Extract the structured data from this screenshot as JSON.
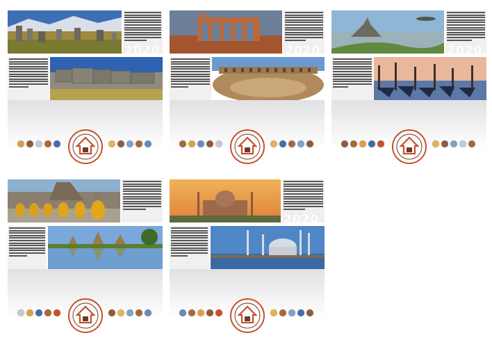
{
  "year_label": "2020",
  "cards": [
    {
      "id": "card-1",
      "photos": [
        "stone-circle-landscape",
        "inca-stone-wall"
      ],
      "show_year": true
    },
    {
      "id": "card-2",
      "photos": [
        "roman-aqueduct-ruins",
        "roman-amphitheater"
      ],
      "show_year": true
    },
    {
      "id": "card-3",
      "photos": [
        "island-abbey-bay",
        "gondolas-venice"
      ],
      "show_year": true
    },
    {
      "id": "card-4",
      "photos": [
        "buddha-statues-row",
        "temple-reflection-pond"
      ],
      "show_year": false
    },
    {
      "id": "card-5",
      "photos": [
        "taj-mahal-sunset",
        "mosque-minarets-waterfront"
      ],
      "show_year": true
    }
  ],
  "colors": {
    "emblem_orange": "#c8502a",
    "emblem_dark": "#6b3a2a",
    "dot_palette": [
      "#d9a04a",
      "#a8693a",
      "#6a8ab8",
      "#c4c9d1",
      "#3f6fa8",
      "#e2b25a",
      "#8f5b3b",
      "#7ea3c9"
    ]
  }
}
